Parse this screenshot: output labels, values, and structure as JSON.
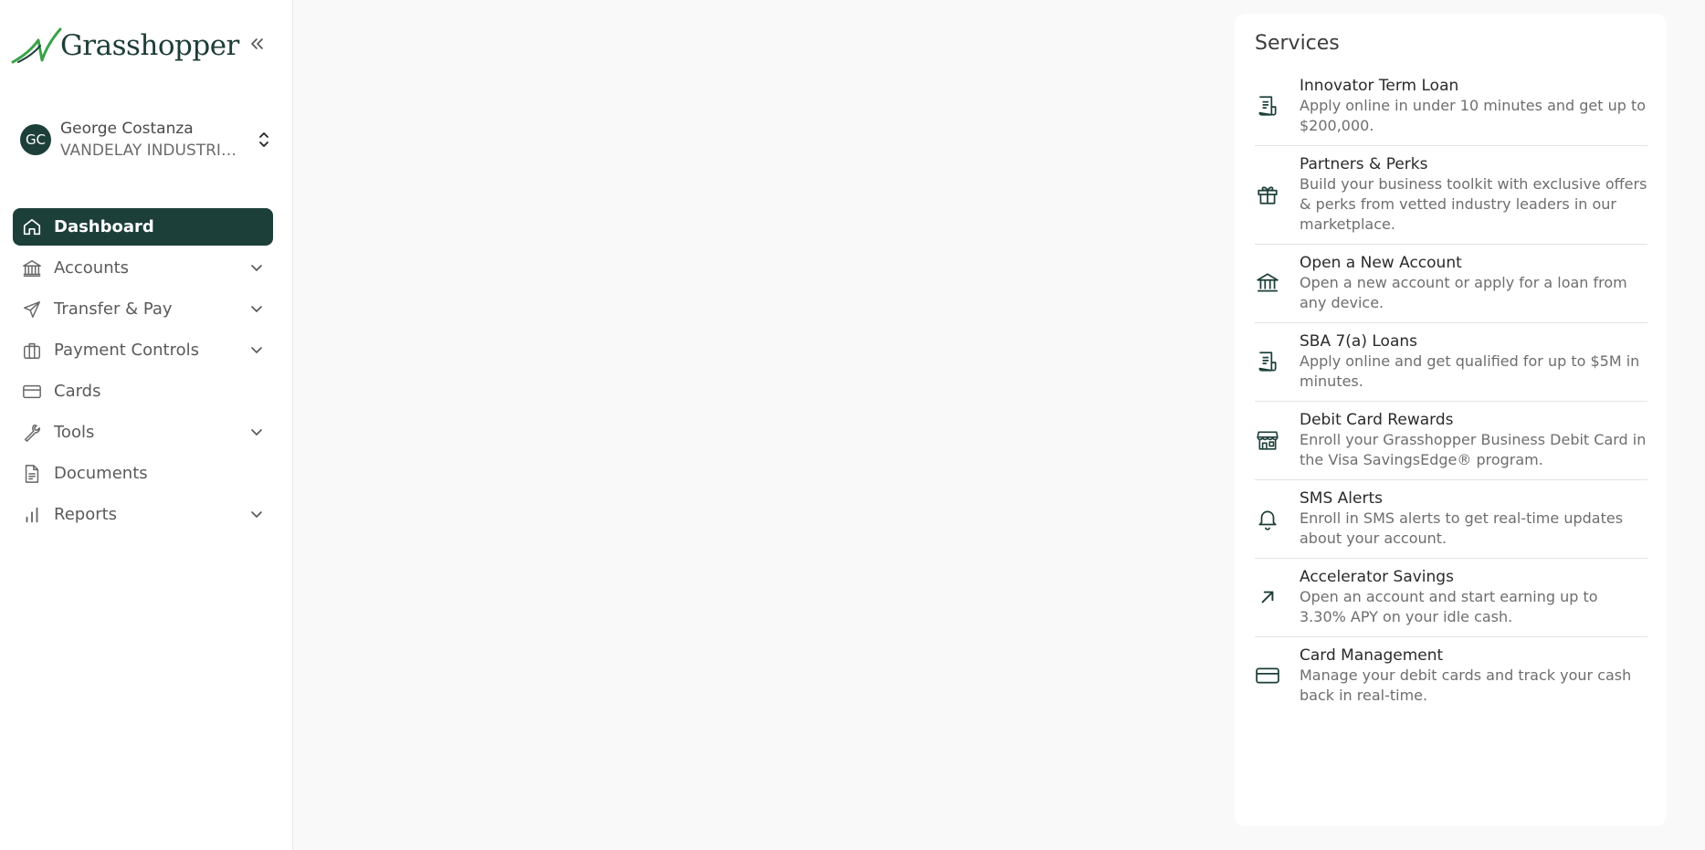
{
  "brand": {
    "name": "Grasshopper"
  },
  "user": {
    "initials": "GC",
    "name": "George Costanza",
    "org": "VANDELAY INDUSTRIES"
  },
  "nav": [
    {
      "label": "Dashboard",
      "icon": "home-icon",
      "active": true,
      "expandable": false
    },
    {
      "label": "Accounts",
      "icon": "bank-icon",
      "active": false,
      "expandable": true
    },
    {
      "label": "Transfer & Pay",
      "icon": "send-icon",
      "active": false,
      "expandable": true
    },
    {
      "label": "Payment Controls",
      "icon": "briefcase-icon",
      "active": false,
      "expandable": true
    },
    {
      "label": "Cards",
      "icon": "card-icon",
      "active": false,
      "expandable": false
    },
    {
      "label": "Tools",
      "icon": "wrench-icon",
      "active": false,
      "expandable": true
    },
    {
      "label": "Documents",
      "icon": "document-icon",
      "active": false,
      "expandable": false
    },
    {
      "label": "Reports",
      "icon": "bar-chart-icon",
      "active": false,
      "expandable": true
    }
  ],
  "services": {
    "title": "Services",
    "items": [
      {
        "title": "Innovator Term Loan",
        "desc": "Apply online in under 10 minutes and get up to $200,000.",
        "icon": "receipt-icon"
      },
      {
        "title": "Partners & Perks",
        "desc": "Build your business toolkit with exclusive offers & perks from vetted industry leaders in our marketplace.",
        "icon": "gift-icon"
      },
      {
        "title": "Open a New Account",
        "desc": "Open a new account or apply for a loan from any device.",
        "icon": "bank-icon"
      },
      {
        "title": "SBA 7(a) Loans",
        "desc": "Apply online and get qualified for up to $5M in minutes.",
        "icon": "receipt-icon"
      },
      {
        "title": "Debit Card Rewards",
        "desc": "Enroll your Grasshopper Business Debit Card in the Visa SavingsEdge® program.",
        "icon": "store-icon"
      },
      {
        "title": "SMS Alerts",
        "desc": "Enroll in SMS alerts to get real-time updates about your account.",
        "icon": "bell-icon"
      },
      {
        "title": "Accelerator Savings",
        "desc": "Open an account and start earning up to 3.30% APY on your idle cash.",
        "icon": "arrow-up-right-icon"
      },
      {
        "title": "Card Management",
        "desc": "Manage your debit cards and track your cash back in real-time.",
        "icon": "card-icon"
      }
    ]
  },
  "colors": {
    "primary": "#1d3f3a",
    "accent_green": "#3aa34a",
    "background": "#f9f9f9"
  }
}
